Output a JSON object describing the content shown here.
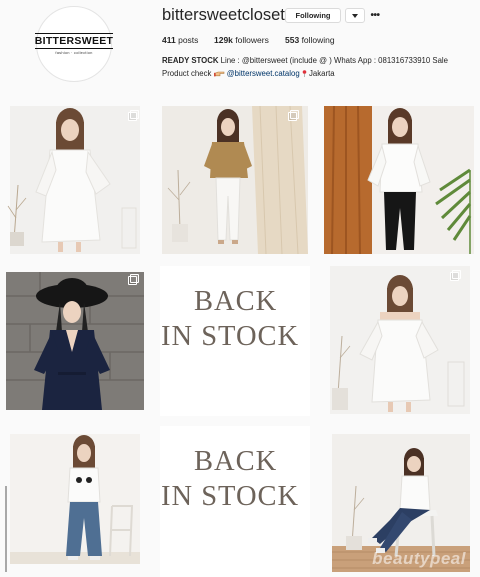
{
  "profile": {
    "logo_text": "BITTERSWEET",
    "logo_tagline": "fashion · collection",
    "username": "bittersweetcloset",
    "follow_button": "Following",
    "more_symbol": "•••",
    "stats": {
      "posts_count": "411",
      "posts_label": "posts",
      "followers_count": "129k",
      "followers_label": "followers",
      "following_count": "553",
      "following_label": "following"
    },
    "bio": {
      "line1_bold": "READY STOCK",
      "line1_rest": " Line : @bittersweet (include @ ) Whats App : 081316733910 Sale",
      "line2_start": "Product check ",
      "line2_link": "@bittersweet.catalog",
      "line2_end": " Jakarta"
    }
  },
  "posts": [
    {
      "alt": "white bell-sleeve dress",
      "multi": true
    },
    {
      "alt": "brown wrap blouse with white jeans",
      "multi": true
    },
    {
      "alt": "white wrap top with black pants",
      "multi": false
    },
    {
      "alt": "navy wrap top with wide-brim hat",
      "multi": true
    },
    {
      "line1": "BACK",
      "line2": "IN STOCK"
    },
    {
      "alt": "white off-shoulder dress",
      "multi": true
    },
    {
      "alt": "white tee with wide-leg jeans",
      "multi": false
    },
    {
      "line1": "BACK",
      "line2": "IN STOCK"
    },
    {
      "alt": "white tee with cropped jeans seated"
    }
  ],
  "watermark": {
    "part1": "beauty",
    "part2": "peal"
  },
  "colors": {
    "back_in_stock_text": "#6d635a",
    "link": "#003569"
  }
}
